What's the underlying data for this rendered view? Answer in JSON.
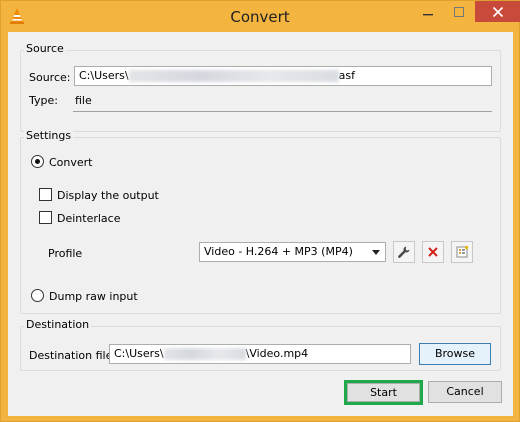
{
  "window": {
    "title": "Convert"
  },
  "source": {
    "group_title": "Source",
    "source_label": "Source:",
    "path_prefix": "C:\\Users\\",
    "path_suffix": "asf",
    "type_label": "Type:",
    "type_value": "file"
  },
  "settings": {
    "group_title": "Settings",
    "convert_label": "Convert",
    "display_output_label": "Display the output",
    "deinterlace_label": "Deinterlace",
    "profile_label": "Profile",
    "profile_value": "Video - H.264 + MP3 (MP4)",
    "dump_raw_label": "Dump raw input"
  },
  "destination": {
    "group_title": "Destination",
    "file_label": "Destination file:",
    "path_prefix": "C:\\Users\\",
    "path_suffix": "\\Video.mp4",
    "browse_label": "Browse"
  },
  "footer": {
    "start_label": "Start",
    "cancel_label": "Cancel"
  },
  "colors": {
    "title_bar": "#f3b53f",
    "close_button": "#c74a3b",
    "highlight": "#1fa94a"
  },
  "icons": [
    "vlc-cone-icon",
    "minimize-icon",
    "maximize-icon",
    "close-icon",
    "wrench-icon",
    "delete-icon",
    "new-profile-icon"
  ]
}
